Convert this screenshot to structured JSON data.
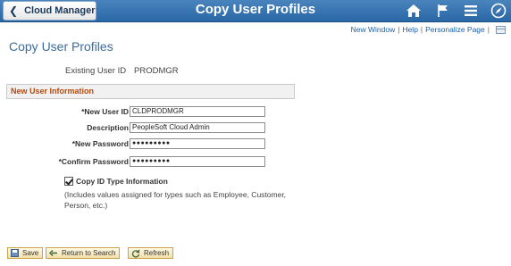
{
  "header": {
    "back_label": "Cloud Manager",
    "title": "Copy User Profiles",
    "icons": [
      "home-icon",
      "flag-icon",
      "menu-icon",
      "navigate-icon"
    ]
  },
  "links": {
    "new_window": "New Window",
    "help": "Help",
    "personalize": "Personalize Page"
  },
  "page_title": "Copy User Profiles",
  "existing_user": {
    "label": "Existing User ID",
    "value": "PRODMGR"
  },
  "section_title": "New User Information",
  "fields": {
    "new_user_id": {
      "label": "*New User ID",
      "value": "CLDPRODMGR"
    },
    "description": {
      "label": "Description",
      "value": "PeopleSoft Cloud Admin"
    },
    "new_password": {
      "label": "*New Password",
      "value": "●●●●●●●●●"
    },
    "confirm_password": {
      "label": "*Confirm Password",
      "value": "●●●●●●●●●"
    }
  },
  "copy_type": {
    "label": "Copy ID Type Information",
    "checked": true,
    "note": "(Includes values assigned for types such as Employee, Customer, Person, etc.)"
  },
  "buttons": {
    "save": "Save",
    "return": "Return to Search",
    "refresh": "Refresh"
  }
}
